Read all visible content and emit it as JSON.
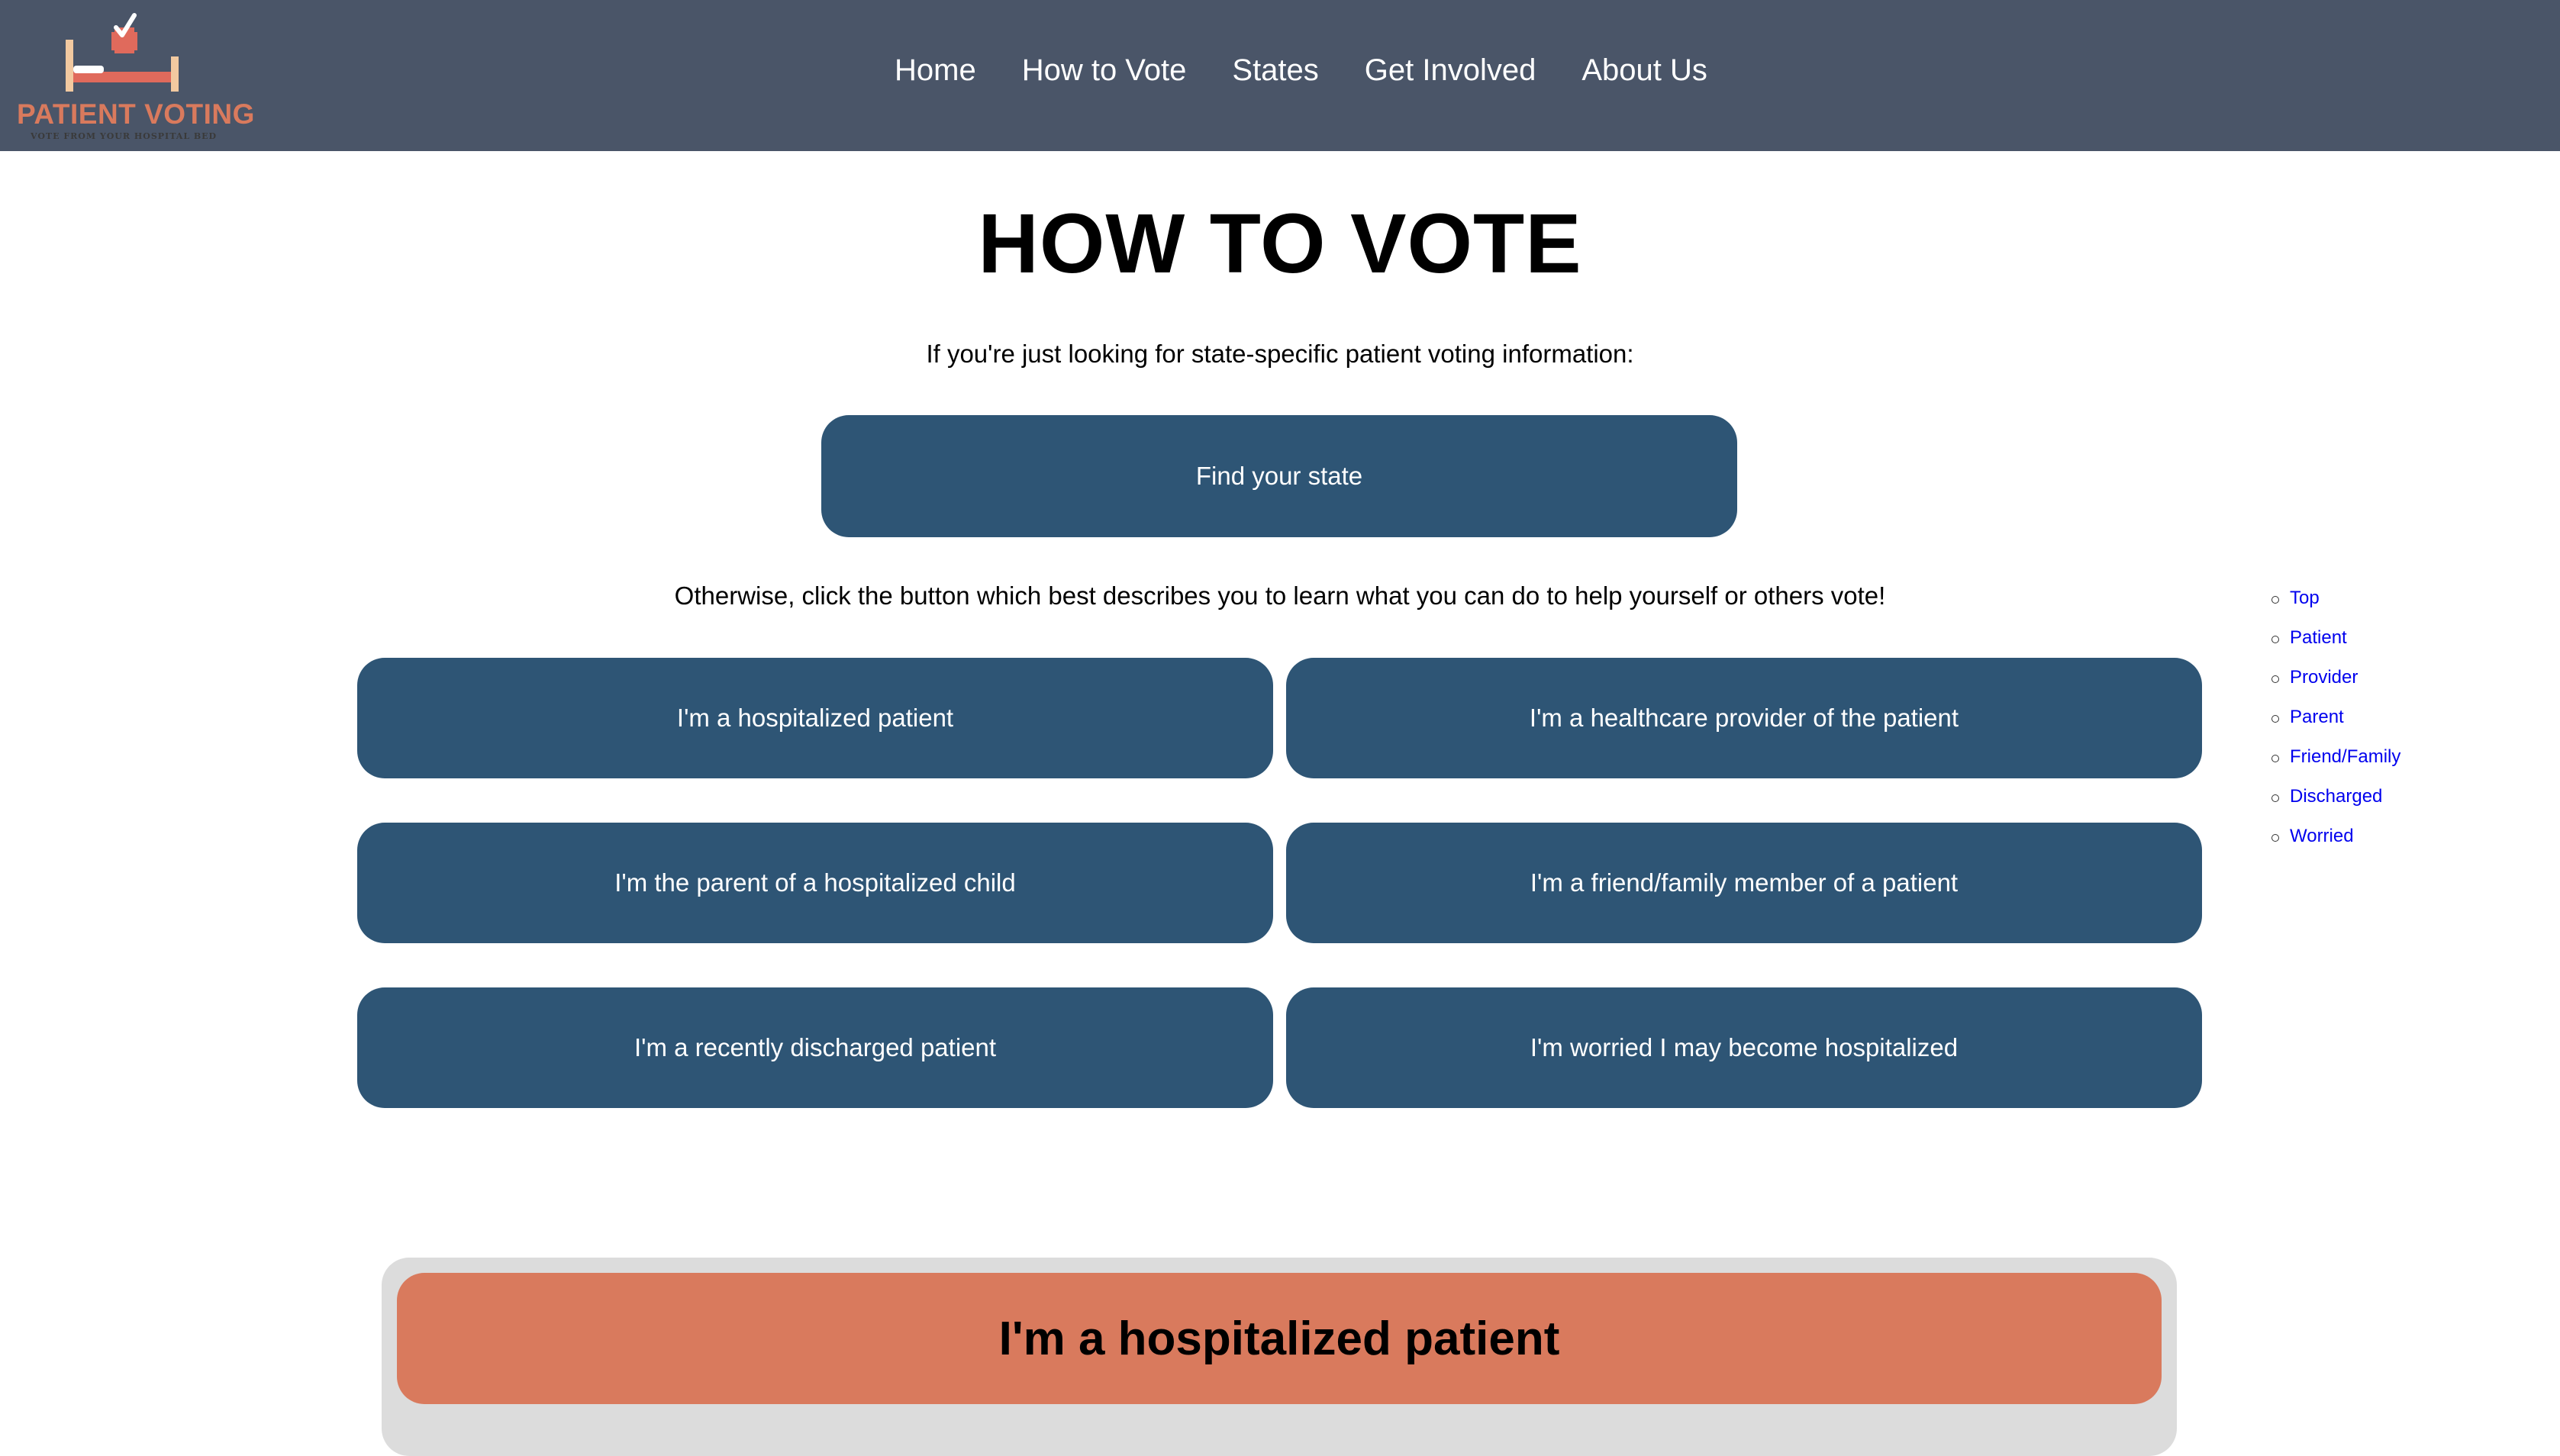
{
  "logo": {
    "title": "PATIENT VOTING",
    "tagline": "VOTE FROM YOUR HOSPITAL BED"
  },
  "nav": {
    "items": [
      {
        "label": "Home"
      },
      {
        "label": "How to Vote"
      },
      {
        "label": "States"
      },
      {
        "label": "Get Involved"
      },
      {
        "label": "About Us"
      }
    ]
  },
  "main": {
    "title": "HOW TO VOTE",
    "intro_state": "If you're just looking for state-specific patient voting information:",
    "find_state_label": "Find your state",
    "intro_roles": "Otherwise, click the button which best describes you to learn what you can do to help yourself or others vote!",
    "role_buttons": [
      {
        "label": "I'm a hospitalized patient"
      },
      {
        "label": "I'm a healthcare provider of the patient"
      },
      {
        "label": "I'm the parent of a hospitalized child"
      },
      {
        "label": "I'm a friend/family member of a patient"
      },
      {
        "label": "I'm a recently discharged patient"
      },
      {
        "label": "I'm worried I may become hospitalized"
      }
    ]
  },
  "toc": {
    "items": [
      {
        "label": "Top"
      },
      {
        "label": "Patient"
      },
      {
        "label": "Provider"
      },
      {
        "label": "Parent"
      },
      {
        "label": "Friend/Family"
      },
      {
        "label": "Discharged"
      },
      {
        "label": "Worried"
      }
    ]
  },
  "section": {
    "heading": "I'm a hospitalized patient"
  },
  "colors": {
    "navbar": "#4a5568",
    "button": "#2e5575",
    "accent": "#d97a5d",
    "section_bg": "#dcdcdc",
    "link": "#0000ee"
  }
}
